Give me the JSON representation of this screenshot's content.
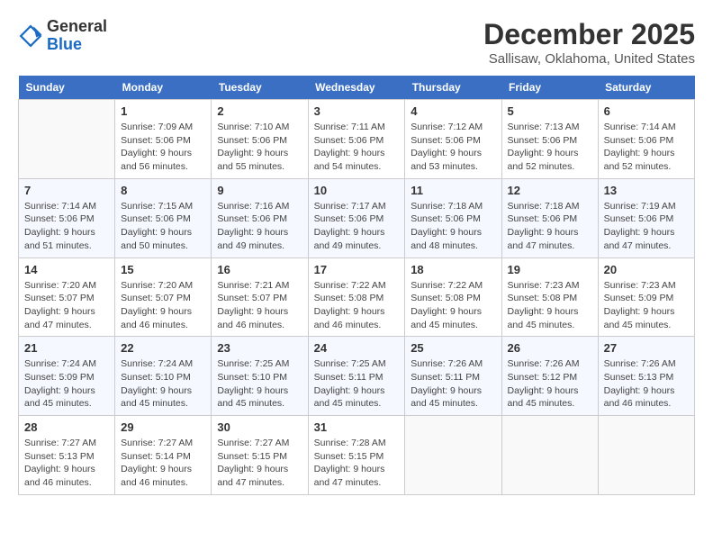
{
  "header": {
    "logo_line1": "General",
    "logo_line2": "Blue",
    "month": "December 2025",
    "location": "Sallisaw, Oklahoma, United States"
  },
  "days_of_week": [
    "Sunday",
    "Monday",
    "Tuesday",
    "Wednesday",
    "Thursday",
    "Friday",
    "Saturday"
  ],
  "weeks": [
    [
      {
        "num": "",
        "sunrise": "",
        "sunset": "",
        "daylight": ""
      },
      {
        "num": "1",
        "sunrise": "Sunrise: 7:09 AM",
        "sunset": "Sunset: 5:06 PM",
        "daylight": "Daylight: 9 hours and 56 minutes."
      },
      {
        "num": "2",
        "sunrise": "Sunrise: 7:10 AM",
        "sunset": "Sunset: 5:06 PM",
        "daylight": "Daylight: 9 hours and 55 minutes."
      },
      {
        "num": "3",
        "sunrise": "Sunrise: 7:11 AM",
        "sunset": "Sunset: 5:06 PM",
        "daylight": "Daylight: 9 hours and 54 minutes."
      },
      {
        "num": "4",
        "sunrise": "Sunrise: 7:12 AM",
        "sunset": "Sunset: 5:06 PM",
        "daylight": "Daylight: 9 hours and 53 minutes."
      },
      {
        "num": "5",
        "sunrise": "Sunrise: 7:13 AM",
        "sunset": "Sunset: 5:06 PM",
        "daylight": "Daylight: 9 hours and 52 minutes."
      },
      {
        "num": "6",
        "sunrise": "Sunrise: 7:14 AM",
        "sunset": "Sunset: 5:06 PM",
        "daylight": "Daylight: 9 hours and 52 minutes."
      }
    ],
    [
      {
        "num": "7",
        "sunrise": "Sunrise: 7:14 AM",
        "sunset": "Sunset: 5:06 PM",
        "daylight": "Daylight: 9 hours and 51 minutes."
      },
      {
        "num": "8",
        "sunrise": "Sunrise: 7:15 AM",
        "sunset": "Sunset: 5:06 PM",
        "daylight": "Daylight: 9 hours and 50 minutes."
      },
      {
        "num": "9",
        "sunrise": "Sunrise: 7:16 AM",
        "sunset": "Sunset: 5:06 PM",
        "daylight": "Daylight: 9 hours and 49 minutes."
      },
      {
        "num": "10",
        "sunrise": "Sunrise: 7:17 AM",
        "sunset": "Sunset: 5:06 PM",
        "daylight": "Daylight: 9 hours and 49 minutes."
      },
      {
        "num": "11",
        "sunrise": "Sunrise: 7:18 AM",
        "sunset": "Sunset: 5:06 PM",
        "daylight": "Daylight: 9 hours and 48 minutes."
      },
      {
        "num": "12",
        "sunrise": "Sunrise: 7:18 AM",
        "sunset": "Sunset: 5:06 PM",
        "daylight": "Daylight: 9 hours and 47 minutes."
      },
      {
        "num": "13",
        "sunrise": "Sunrise: 7:19 AM",
        "sunset": "Sunset: 5:06 PM",
        "daylight": "Daylight: 9 hours and 47 minutes."
      }
    ],
    [
      {
        "num": "14",
        "sunrise": "Sunrise: 7:20 AM",
        "sunset": "Sunset: 5:07 PM",
        "daylight": "Daylight: 9 hours and 47 minutes."
      },
      {
        "num": "15",
        "sunrise": "Sunrise: 7:20 AM",
        "sunset": "Sunset: 5:07 PM",
        "daylight": "Daylight: 9 hours and 46 minutes."
      },
      {
        "num": "16",
        "sunrise": "Sunrise: 7:21 AM",
        "sunset": "Sunset: 5:07 PM",
        "daylight": "Daylight: 9 hours and 46 minutes."
      },
      {
        "num": "17",
        "sunrise": "Sunrise: 7:22 AM",
        "sunset": "Sunset: 5:08 PM",
        "daylight": "Daylight: 9 hours and 46 minutes."
      },
      {
        "num": "18",
        "sunrise": "Sunrise: 7:22 AM",
        "sunset": "Sunset: 5:08 PM",
        "daylight": "Daylight: 9 hours and 45 minutes."
      },
      {
        "num": "19",
        "sunrise": "Sunrise: 7:23 AM",
        "sunset": "Sunset: 5:08 PM",
        "daylight": "Daylight: 9 hours and 45 minutes."
      },
      {
        "num": "20",
        "sunrise": "Sunrise: 7:23 AM",
        "sunset": "Sunset: 5:09 PM",
        "daylight": "Daylight: 9 hours and 45 minutes."
      }
    ],
    [
      {
        "num": "21",
        "sunrise": "Sunrise: 7:24 AM",
        "sunset": "Sunset: 5:09 PM",
        "daylight": "Daylight: 9 hours and 45 minutes."
      },
      {
        "num": "22",
        "sunrise": "Sunrise: 7:24 AM",
        "sunset": "Sunset: 5:10 PM",
        "daylight": "Daylight: 9 hours and 45 minutes."
      },
      {
        "num": "23",
        "sunrise": "Sunrise: 7:25 AM",
        "sunset": "Sunset: 5:10 PM",
        "daylight": "Daylight: 9 hours and 45 minutes."
      },
      {
        "num": "24",
        "sunrise": "Sunrise: 7:25 AM",
        "sunset": "Sunset: 5:11 PM",
        "daylight": "Daylight: 9 hours and 45 minutes."
      },
      {
        "num": "25",
        "sunrise": "Sunrise: 7:26 AM",
        "sunset": "Sunset: 5:11 PM",
        "daylight": "Daylight: 9 hours and 45 minutes."
      },
      {
        "num": "26",
        "sunrise": "Sunrise: 7:26 AM",
        "sunset": "Sunset: 5:12 PM",
        "daylight": "Daylight: 9 hours and 45 minutes."
      },
      {
        "num": "27",
        "sunrise": "Sunrise: 7:26 AM",
        "sunset": "Sunset: 5:13 PM",
        "daylight": "Daylight: 9 hours and 46 minutes."
      }
    ],
    [
      {
        "num": "28",
        "sunrise": "Sunrise: 7:27 AM",
        "sunset": "Sunset: 5:13 PM",
        "daylight": "Daylight: 9 hours and 46 minutes."
      },
      {
        "num": "29",
        "sunrise": "Sunrise: 7:27 AM",
        "sunset": "Sunset: 5:14 PM",
        "daylight": "Daylight: 9 hours and 46 minutes."
      },
      {
        "num": "30",
        "sunrise": "Sunrise: 7:27 AM",
        "sunset": "Sunset: 5:15 PM",
        "daylight": "Daylight: 9 hours and 47 minutes."
      },
      {
        "num": "31",
        "sunrise": "Sunrise: 7:28 AM",
        "sunset": "Sunset: 5:15 PM",
        "daylight": "Daylight: 9 hours and 47 minutes."
      },
      {
        "num": "",
        "sunrise": "",
        "sunset": "",
        "daylight": ""
      },
      {
        "num": "",
        "sunrise": "",
        "sunset": "",
        "daylight": ""
      },
      {
        "num": "",
        "sunrise": "",
        "sunset": "",
        "daylight": ""
      }
    ]
  ]
}
